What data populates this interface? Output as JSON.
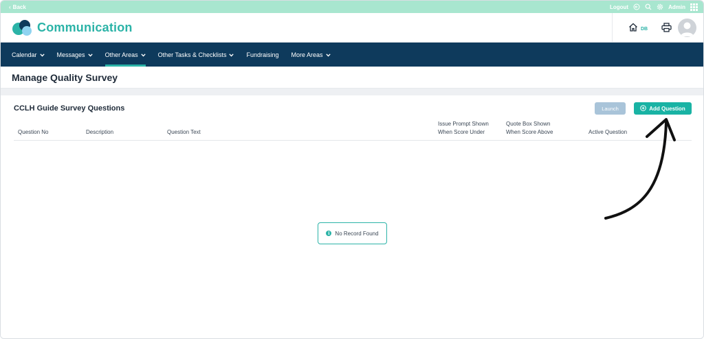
{
  "topbar": {
    "back_label": "Back",
    "logout_label": "Logout",
    "user_label": "Admin",
    "bg_color": "#a8e6cf"
  },
  "header": {
    "app_title": "Communication",
    "home_badge": "DB",
    "accent_color": "#2bb3a7"
  },
  "nav": {
    "bg_color": "#0e3a5c",
    "items": [
      {
        "label": "Calendar",
        "dropdown": true,
        "active": false
      },
      {
        "label": "Messages",
        "dropdown": true,
        "active": false
      },
      {
        "label": "Other Areas",
        "dropdown": true,
        "active": true
      },
      {
        "label": "Other Tasks & Checklists",
        "dropdown": true,
        "active": false
      },
      {
        "label": "Fundraising",
        "dropdown": false,
        "active": false
      },
      {
        "label": "More Areas",
        "dropdown": true,
        "active": false
      }
    ]
  },
  "page": {
    "title": "Manage Quality Survey"
  },
  "section": {
    "title": "CCLH Guide Survey Questions",
    "launch_label": "Launch",
    "add_label": "Add Question"
  },
  "table": {
    "columns": [
      {
        "line1": "Question No",
        "line2": ""
      },
      {
        "line1": "Description",
        "line2": ""
      },
      {
        "line1": "Question Text",
        "line2": ""
      },
      {
        "line1": "Issue Prompt Shown",
        "line2": "When Score Under"
      },
      {
        "line1": "Quote Box Shown",
        "line2": "When Score Above"
      },
      {
        "line1": "Active Question",
        "line2": ""
      }
    ],
    "rows": [],
    "empty_message": "No Record Found"
  },
  "icons": {
    "back": "chevron-left-icon",
    "logout": "logout-icon",
    "search": "search-icon",
    "settings": "gear-icon",
    "apps": "grid-icon",
    "home": "home-icon",
    "print": "printer-icon",
    "avatar": "user-avatar-icon",
    "add": "plus-circle-icon",
    "info": "info-icon",
    "annotation": "curved-arrow-icon"
  }
}
